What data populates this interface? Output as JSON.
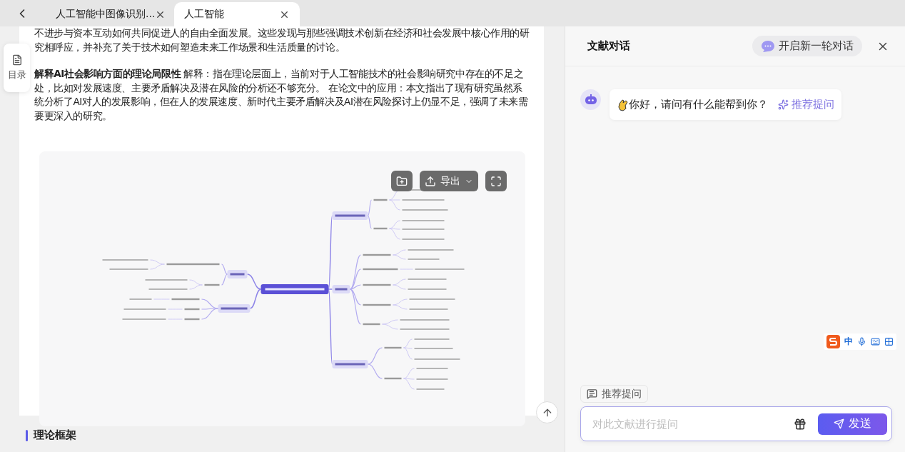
{
  "tabs": [
    {
      "label": "人工智能中图像识别...",
      "selected": false
    },
    {
      "label": "人工智能",
      "selected": true
    }
  ],
  "toc_button": {
    "label": "目录"
  },
  "document": {
    "paragraphs": [
      "不进步与资本互动如何共同促进人的自由全面发展。这些发现与那些强调技术创新在经济和社会发展中核心作用的研究相呼应，并补充了关于技术如何塑造未来工作场景和生活质量的讨论。",
      "**解释AI社会影响方面的理论局限性** 解释：指在理论层面上，当前对于人工智能技术的社会影响研究中存在的不足之处，比如对发展速度、主要矛盾解决及潜在风险的分析还不够充分。 在论文中的应用：本文指出了现有研究虽然系统分析了AI对人的发展影响，但在人的发展速度、新时代主要矛盾解决及AI潜在风险探讨上仍显不足，强调了未来需要更深入的研究。"
    ],
    "mind_map": {
      "export_label": "导出"
    },
    "section_heading": "理论框架"
  },
  "chat": {
    "title": "文献对话",
    "new_chat_label": "开启新一轮对话",
    "messages": [
      {
        "text": "你好，请问有什么能帮到你？",
        "suggest_label": "推荐提问"
      }
    ],
    "suggest_chip": "推荐提问",
    "input": {
      "placeholder": "对此文献进行提问"
    },
    "send_label": "发送"
  },
  "ime_toolbar": {
    "mode": "中"
  }
}
